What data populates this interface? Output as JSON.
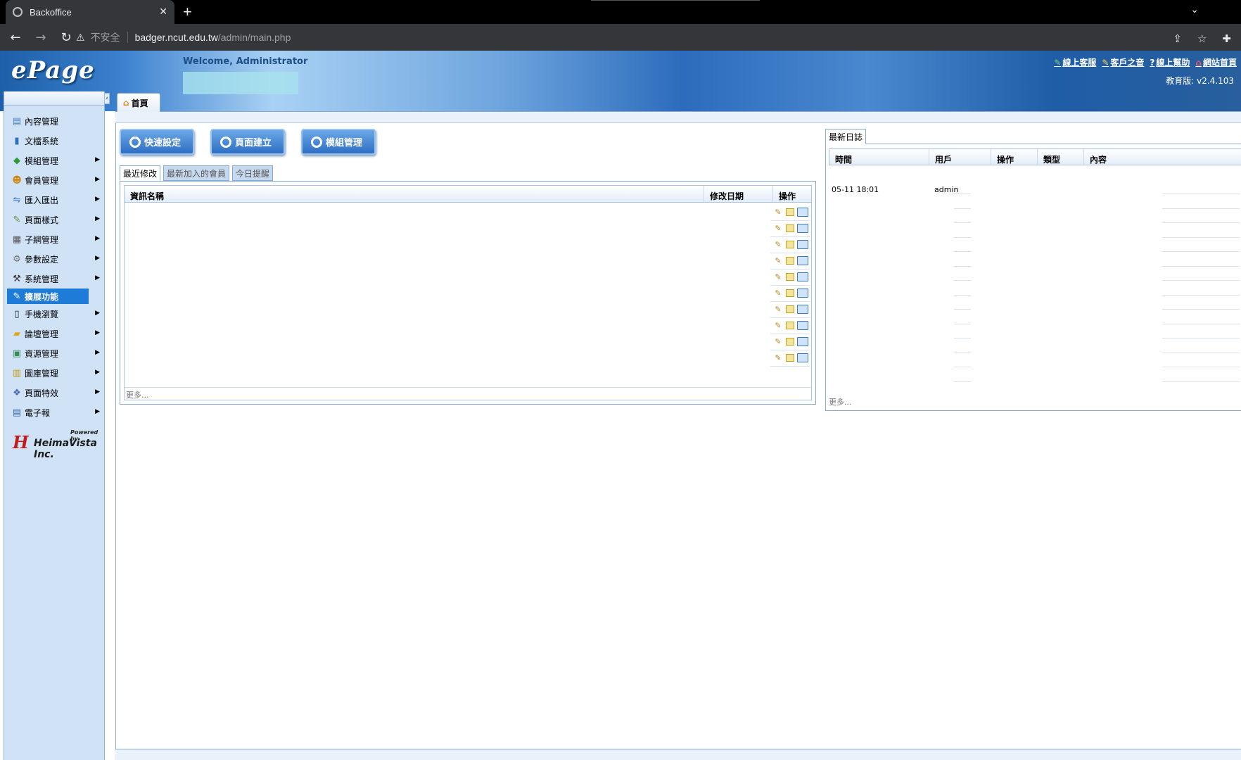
{
  "browser": {
    "tab_title": "Backoffice",
    "insecure_label": "不安全",
    "url_host": "badger.ncut.edu.tw",
    "url_path": "/admin/main.php"
  },
  "header": {
    "logo": "ePage",
    "welcome": "Welcome, Administrator",
    "links": [
      {
        "label": "線上客服",
        "icon": "chat-icon"
      },
      {
        "label": "客戶之音",
        "icon": "voice-icon"
      },
      {
        "label": "線上幫助",
        "icon": "help-icon"
      },
      {
        "label": "網站首頁",
        "icon": "home-icon"
      }
    ],
    "version": "教育版: v2.4.103"
  },
  "sidebar": {
    "items": [
      {
        "label": "內容管理",
        "icon": "content-icon",
        "arrow": false
      },
      {
        "label": "文檔系統",
        "icon": "docs-icon",
        "arrow": false
      },
      {
        "label": "模組管理",
        "icon": "module-icon",
        "arrow": true
      },
      {
        "label": "會員管理",
        "icon": "members-icon",
        "arrow": true
      },
      {
        "label": "匯入匯出",
        "icon": "import-export-icon",
        "arrow": true
      },
      {
        "label": "頁面樣式",
        "icon": "style-icon",
        "arrow": true
      },
      {
        "label": "子網管理",
        "icon": "subsite-icon",
        "arrow": true
      },
      {
        "label": "參數設定",
        "icon": "settings-icon",
        "arrow": true
      },
      {
        "label": "系統管理",
        "icon": "system-icon",
        "arrow": true
      },
      {
        "label": "擴展功能",
        "icon": "extension-icon",
        "arrow": false
      },
      {
        "label": "手機瀏覽",
        "icon": "mobile-icon",
        "arrow": true
      },
      {
        "label": "論壇管理",
        "icon": "forum-icon",
        "arrow": true
      },
      {
        "label": "資源管理",
        "icon": "resource-icon",
        "arrow": true
      },
      {
        "label": "圖庫管理",
        "icon": "gallery-icon",
        "arrow": true
      },
      {
        "label": "頁面特效",
        "icon": "effects-icon",
        "arrow": true
      },
      {
        "label": "電子報",
        "icon": "newsletter-icon",
        "arrow": true
      }
    ],
    "powered_by": "Powered by",
    "company": "HeimaVista Inc."
  },
  "main": {
    "home_tab": "首頁",
    "actions": [
      "快速設定",
      "頁面建立",
      "模組管理"
    ],
    "subtabs": [
      "最近修改",
      "最新加入的會員",
      "今日提醒"
    ],
    "columns": [
      "資訊名稱",
      "修改日期",
      "操作"
    ],
    "row_count": 10,
    "more": "更多..."
  },
  "log": {
    "tab": "最新日誌",
    "columns": [
      "時間",
      "用戶",
      "操作",
      "類型",
      "內容"
    ],
    "rows": [
      {
        "time": "05-11 18:01",
        "user": "admin"
      }
    ],
    "more": "更多..."
  }
}
